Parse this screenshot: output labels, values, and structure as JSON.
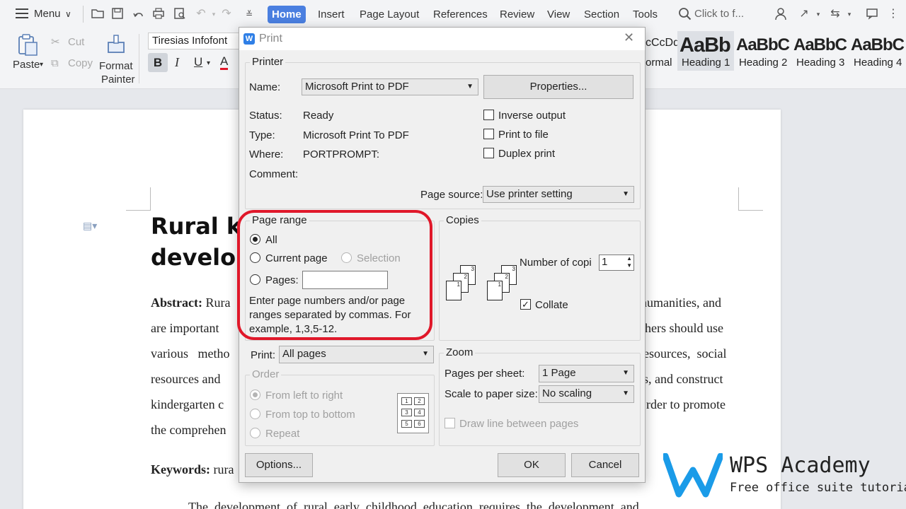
{
  "menubar": {
    "menu_label": "Menu",
    "tabs": [
      "Home",
      "Insert",
      "Page Layout",
      "References",
      "Review",
      "View",
      "Section",
      "Tools"
    ],
    "active_tab": "Home",
    "search_placeholder": "Click to f..."
  },
  "ribbon": {
    "paste_label": "Paste",
    "cut_label": "Cut",
    "copy_label": "Copy",
    "format_painter_label_1": "Format",
    "format_painter_label_2": "Painter",
    "font_name": "Tiresias Infofont",
    "bold_label": "B",
    "italic_label": "I",
    "underline_label": "U",
    "font_color_label": "A",
    "styles": [
      {
        "sample": "cCcDd",
        "name": "ormal"
      },
      {
        "sample": "AaBb",
        "name": "Heading 1"
      },
      {
        "sample": "AaBbC",
        "name": "Heading 2"
      },
      {
        "sample": "AaBbC",
        "name": "Heading 3"
      },
      {
        "sample": "AaBbC",
        "name": "Heading 4"
      }
    ]
  },
  "document": {
    "title_line1": "Rural k",
    "title_line2": "develop",
    "lines_left": [
      {
        "bold": "Abstract:",
        "text": " Rura"
      },
      {
        "bold": "",
        "text": "are important"
      },
      {
        "bold": "",
        "text": "various   metho"
      },
      {
        "bold": "",
        "text": "resources and"
      },
      {
        "bold": "",
        "text": "kindergarten c"
      },
      {
        "bold": "",
        "text": "the comprehen"
      }
    ],
    "lines_right": [
      "humanities, and",
      "hers should use",
      "esources,  social",
      "s, and construct",
      "rder to promote"
    ],
    "keywords_bold": "Keywords:",
    "keywords_text": " rura",
    "bottom_line": "The  development  of  rural  early  childhood  education  requires  the  development  and"
  },
  "dialog": {
    "title": "Print",
    "printer": {
      "legend": "Printer",
      "name_label": "Name:",
      "name_value": "Microsoft Print to PDF",
      "properties_button": "Properties...",
      "status_label": "Status:",
      "status_value": "Ready",
      "type_label": "Type:",
      "type_value": "Microsoft Print To PDF",
      "where_label": "Where:",
      "where_value": "PORTPROMPT:",
      "comment_label": "Comment:",
      "inverse_output": "Inverse output",
      "print_to_file": "Print to file",
      "duplex_print": "Duplex print",
      "page_source_label": "Page source:",
      "page_source_value": "Use printer setting"
    },
    "page_range": {
      "legend": "Page range",
      "all": "All",
      "current_page": "Current page",
      "selection": "Selection",
      "pages": "Pages:",
      "hint_1": "Enter page numbers and/or page",
      "hint_2": "ranges separated by commas. For",
      "hint_3": "example, 1,3,5-12."
    },
    "copies": {
      "legend": "Copies",
      "number_label": "Number of copi",
      "number_value": "1",
      "collate": "Collate",
      "sheet_numbers": [
        "1",
        "2",
        "3"
      ]
    },
    "print_label": "Print:",
    "print_value": "All pages",
    "order": {
      "legend": "Order",
      "left_to_right": "From left to right",
      "top_to_bottom": "From top to bottom",
      "repeat": "Repeat",
      "grid_numbers": [
        "1",
        "2",
        "3",
        "4",
        "5",
        "6"
      ]
    },
    "zoom": {
      "legend": "Zoom",
      "pages_per_sheet_label": "Pages per sheet:",
      "pages_per_sheet_value": "1 Page",
      "scale_label": "Scale to paper size:",
      "scale_value": "No scaling",
      "draw_lines": "Draw line between pages"
    },
    "options_button": "Options...",
    "ok_button": "OK",
    "cancel_button": "Cancel"
  },
  "watermark": {
    "title": "WPS Academy",
    "subtitle": "Free office suite tutorials"
  },
  "colors": {
    "accent": "#4a7fe0",
    "highlight_ring": "#e0182a",
    "wps_logo": "#1a9be8"
  }
}
